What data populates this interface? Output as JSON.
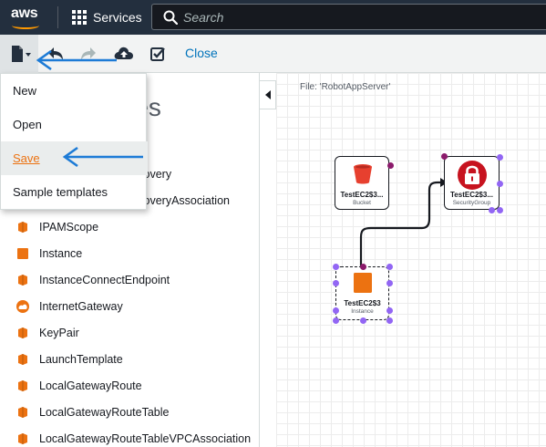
{
  "topbar": {
    "logo_text": "aws",
    "services_label": "Services",
    "search_placeholder": "Search"
  },
  "toolbar": {
    "close_label": "Close"
  },
  "file_menu": {
    "items": [
      {
        "label": "New"
      },
      {
        "label": "Open"
      },
      {
        "label": "Save"
      },
      {
        "label": "Sample templates"
      }
    ]
  },
  "left_panel": {
    "heading": "types",
    "items": [
      {
        "label": "scovery",
        "icon": "resource-icon"
      },
      {
        "label": "scoveryAssociation",
        "icon": "resource-icon"
      },
      {
        "label": "IPAMScope",
        "icon": "resource-icon"
      },
      {
        "label": "Instance",
        "icon": "instance-icon"
      },
      {
        "label": "InstanceConnectEndpoint",
        "icon": "resource-icon"
      },
      {
        "label": "InternetGateway",
        "icon": "internet-gateway-icon"
      },
      {
        "label": "KeyPair",
        "icon": "resource-icon"
      },
      {
        "label": "LaunchTemplate",
        "icon": "resource-icon"
      },
      {
        "label": "LocalGatewayRoute",
        "icon": "resource-icon"
      },
      {
        "label": "LocalGatewayRouteTable",
        "icon": "resource-icon"
      },
      {
        "label": "LocalGatewayRouteTableVPCAssociation",
        "icon": "resource-icon"
      }
    ]
  },
  "canvas": {
    "file_label": "File: 'RobotAppServer'",
    "nodes": {
      "bucket": {
        "title": "TestEC2$3...",
        "type": "Bucket"
      },
      "security_group": {
        "title": "TestEC2$3...",
        "type": "SecurityGroup"
      },
      "instance": {
        "title": "TestEC2$3",
        "type": "Instance"
      }
    }
  },
  "colors": {
    "aws_orange": "#ff9900",
    "ec2_orange": "#ec7211",
    "s3_red": "#e7402f",
    "security_red": "#c7131f",
    "link_blue": "#0073bb",
    "annotation_arrow": "#1d7bd6"
  }
}
